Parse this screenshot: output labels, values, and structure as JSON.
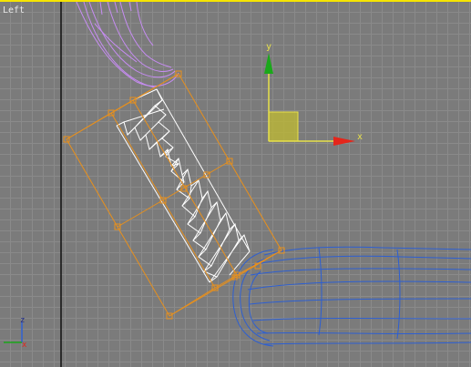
{
  "viewport": {
    "label": "Left",
    "border_color": "#f6e400",
    "grid_color": "#8a8a8a",
    "background_color": "#7b7b7b"
  },
  "gizmo": {
    "x_label": "x",
    "y_label": "y",
    "x_axis_color": "#e4261b",
    "y_axis_color": "#1aa81a",
    "plane_handle_color": "#cdcc44"
  },
  "axis_tripod": {
    "x_label": "x",
    "z_label": "z"
  },
  "colors": {
    "gizmo_cage": "#e8901c",
    "selected_mesh": "#ffffff",
    "blue_mesh": "#2d5fd2",
    "purple_mesh": "#c68cf2",
    "world_axis": "#111111"
  }
}
